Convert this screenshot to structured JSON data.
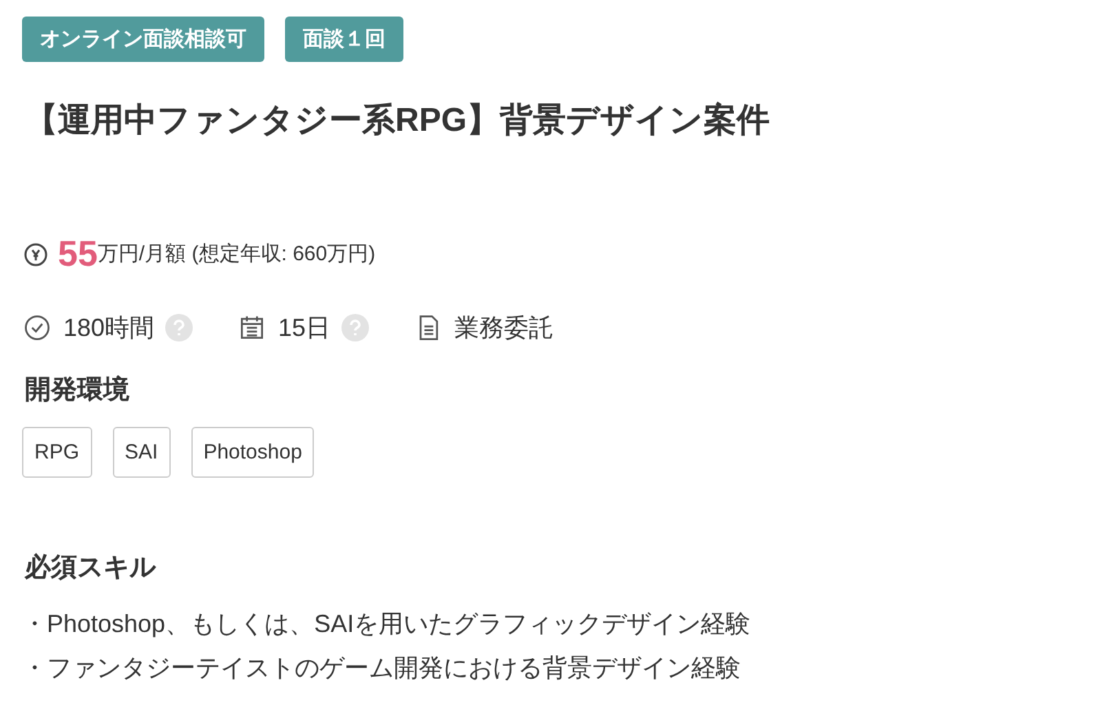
{
  "badges": [
    "オンライン面談相談可",
    "面談１回"
  ],
  "title": "【運用中ファンタジー系RPG】背景デザイン案件",
  "salary": {
    "amount": "55",
    "unit": "万円/月額 (想定年収: 660万円)"
  },
  "info": [
    {
      "kind": "clock",
      "text": "180時間",
      "help": true
    },
    {
      "kind": "calendar",
      "text": "15日",
      "help": true
    },
    {
      "kind": "document",
      "text": "業務委託",
      "help": false
    }
  ],
  "environment": {
    "heading": "開発環境",
    "tags": [
      "RPG",
      "SAI",
      "Photoshop"
    ]
  },
  "skills": {
    "heading": "必須スキル",
    "items": [
      "・Photoshop、もしくは、SAIを用いたグラフィックデザイン経験",
      "・ファンタジーテイストのゲーム開発における背景デザイン経験"
    ]
  }
}
